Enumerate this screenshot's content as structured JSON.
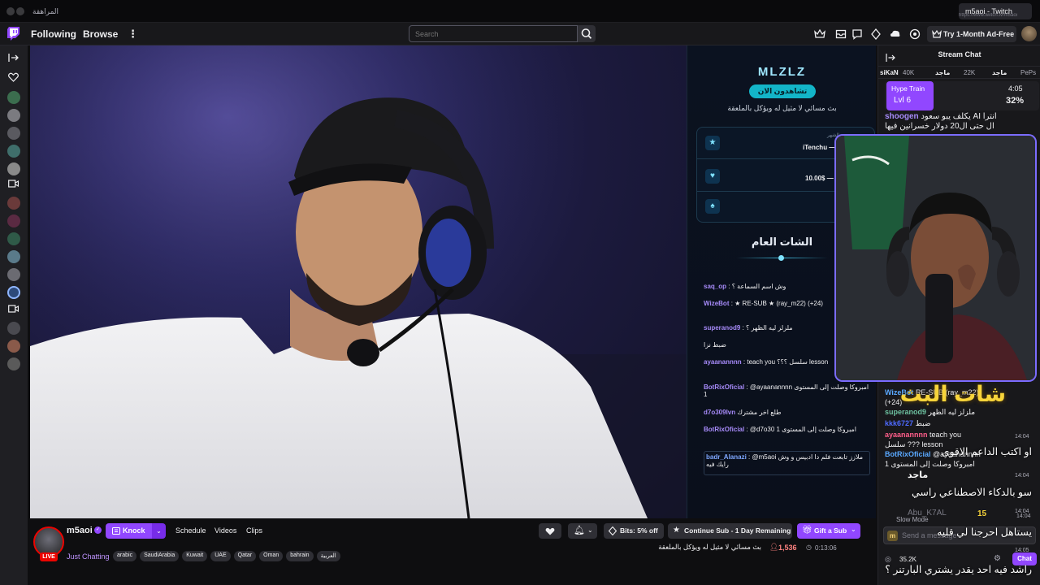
{
  "browser": {
    "tabs": [
      "المراهقة",
      "m5aoi - Twitch"
    ],
    "url": "https://www.twitch.tv/m5aoi"
  },
  "nav": {
    "following": "Following",
    "browse": "Browse",
    "search_placeholder": "Search",
    "prime_label": "Try 1-Month Ad-Free"
  },
  "overlay": {
    "brand": "MLZLZ",
    "live_pill": "تشاهدون الان",
    "subtitle": "بث مسائي لا مثيل له ويؤكل بالملعقة",
    "card1_label": "الشهر",
    "card1_value": "iTenchu —",
    "card2_value": "10.00$ —",
    "card3_value": "ro",
    "chat_title": "الشات العام",
    "messages": [
      {
        "user": "saq_op",
        "text": "وش اسم السماعة ؟"
      },
      {
        "user": "WizeBot",
        "text": "★ RE-SUB ★ (ray_m22) (+24)"
      },
      {
        "user": "superanod9",
        "text": "ملزلز ليه الظهر ؟"
      },
      {
        "user": "",
        "text": "ضبط نزا"
      },
      {
        "user": "ayaanannnn",
        "text": "teach you سلسل ؟؟؟ lesson"
      },
      {
        "user": "BotRixOficial",
        "text": "@ayaanannnn امبروكا وصلت إلى المستوى 1"
      },
      {
        "user": "d7o309lvn",
        "text": "طلع اخر مشترك"
      },
      {
        "user": "BotRixOficial",
        "text": "@d7o30 امبروكا وصلت إلى المستوى 1"
      },
      {
        "user": "badr_Alanazi",
        "text": "@m5aoi ملازز تابعت فلم دا ادبيس و وش رايك فيه"
      }
    ]
  },
  "channel": {
    "name": "m5aoi",
    "live_badge": "LIVE",
    "knock_label": "Knock",
    "schedule": "Schedule",
    "videos": "Videos",
    "clips": "Clips",
    "category": "Just Chatting",
    "tags": [
      "arabic",
      "SaudiArabia",
      "Kuwait",
      "UAE",
      "Qatar",
      "Oman",
      "bahrain",
      "العربية"
    ],
    "bits_label": "Bits: 5% off",
    "continue_sub": "Continue Sub - 1 Day Remaining",
    "gift_sub": "Gift a Sub",
    "title": "بث مسائي لا مثيل له ويؤكل بالملعقة",
    "viewers": "1,536",
    "uptime": "0:13:06"
  },
  "chat": {
    "header": "Stream Chat",
    "leaderboard": [
      {
        "name": "siKaN",
        "amount": "40K"
      },
      {
        "name": "ماجد",
        "amount": "22K"
      },
      {
        "name": "ماجد",
        "amount": "PePs"
      }
    ],
    "hype_train": {
      "label": "Hype Train",
      "level": "Lvl 6",
      "timer": "4:05",
      "progress_label": "32%",
      "progress": 0.32
    },
    "messages": [
      {
        "user": "shoogen",
        "text": "يكلف يبو سعود AI انترا ال حتى ال20 دولار خسرانين فيها"
      },
      {
        "user": "WizeBot",
        "text": "RE-SUB (ray_m22) (+24)"
      },
      {
        "user": "superanod9",
        "text": "ملزلز ليه الظهر"
      },
      {
        "user": "kkk6727",
        "text": "ضبط"
      },
      {
        "user": "ayaanannnn",
        "text": "teach you سلسل ??? lesson"
      },
      {
        "user": "BotRixOficial",
        "text": "@ayaanannnn امبروكا وصلت إلى المستوى 1"
      }
    ],
    "timestamps": [
      "14:04",
      "14:04",
      "14:04",
      "14:04",
      "14:05"
    ],
    "slow_mode": "Slow Mode",
    "input_placeholder": "Send a message",
    "points": "35.2K",
    "chat_button": "Chat",
    "caption_lines": [
      "او اكتب الداعم الاقوى",
      "سو بالدكاء الاصطناعي راسي",
      "يستاهل احرجنا لي قليه",
      "راشد فيه احد يقدر يشتري البارتنر ؟"
    ]
  },
  "webcam": {
    "name_tag": "ماجد",
    "overlay_text": "شات البث",
    "donation_user": "Abu_K7AL",
    "donation_amount": "15"
  },
  "colors": {
    "twitch_purple": "#9147ff",
    "live_red": "#eb0400",
    "overlay_accent": "#7fe3ff"
  }
}
